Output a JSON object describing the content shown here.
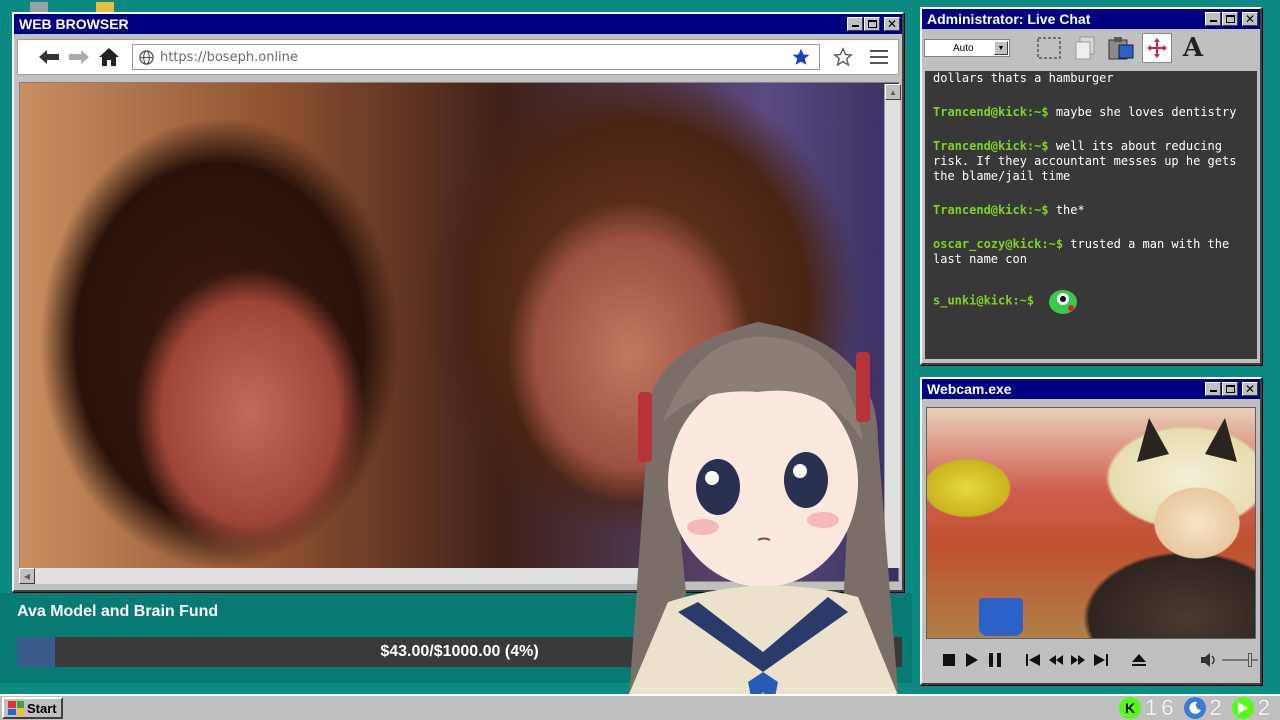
{
  "browser": {
    "title": "WEB BROWSER",
    "url": "https://boseph.online"
  },
  "chat": {
    "title": "Administrator: Live Chat",
    "font_select": "Auto",
    "messages": [
      {
        "user": "",
        "text": "dollars thats a hamburger"
      },
      {
        "user": "Trancend@kick:~$",
        "text": "maybe she loves dentistry"
      },
      {
        "user": "Trancend@kick:~$",
        "text": "well its about reducing risk. If they accountant messes up he gets the blame/jail time"
      },
      {
        "user": "Trancend@kick:~$",
        "text": "the*"
      },
      {
        "user": "oscar_cozy@kick:~$",
        "text": "trusted a man with the last name con"
      },
      {
        "user": "s_unki@kick:~$",
        "text": ""
      }
    ],
    "user_color": "#7ed321"
  },
  "webcam": {
    "title": "Webcam.exe"
  },
  "fund": {
    "title": "Ava Model and Brain Fund",
    "progress_text": "$43.00/$1000.00 (4%)",
    "progress": 0.043,
    "fill_color": "#3a5a8a"
  },
  "taskbar": {
    "start_label": "Start",
    "tray": [
      {
        "icon": "kick-icon",
        "value": "1",
        "color": "#53fc18"
      },
      {
        "icon": "moon-icon",
        "value": "6",
        "color": "#3a7bd5"
      },
      {
        "icon": "play-icon",
        "value": "2",
        "color": "#53fc18"
      },
      {
        "value": "2"
      }
    ]
  },
  "colors": {
    "desktop": "#0b8a82",
    "titlebar": "#000080",
    "window": "#c0c0c0"
  }
}
